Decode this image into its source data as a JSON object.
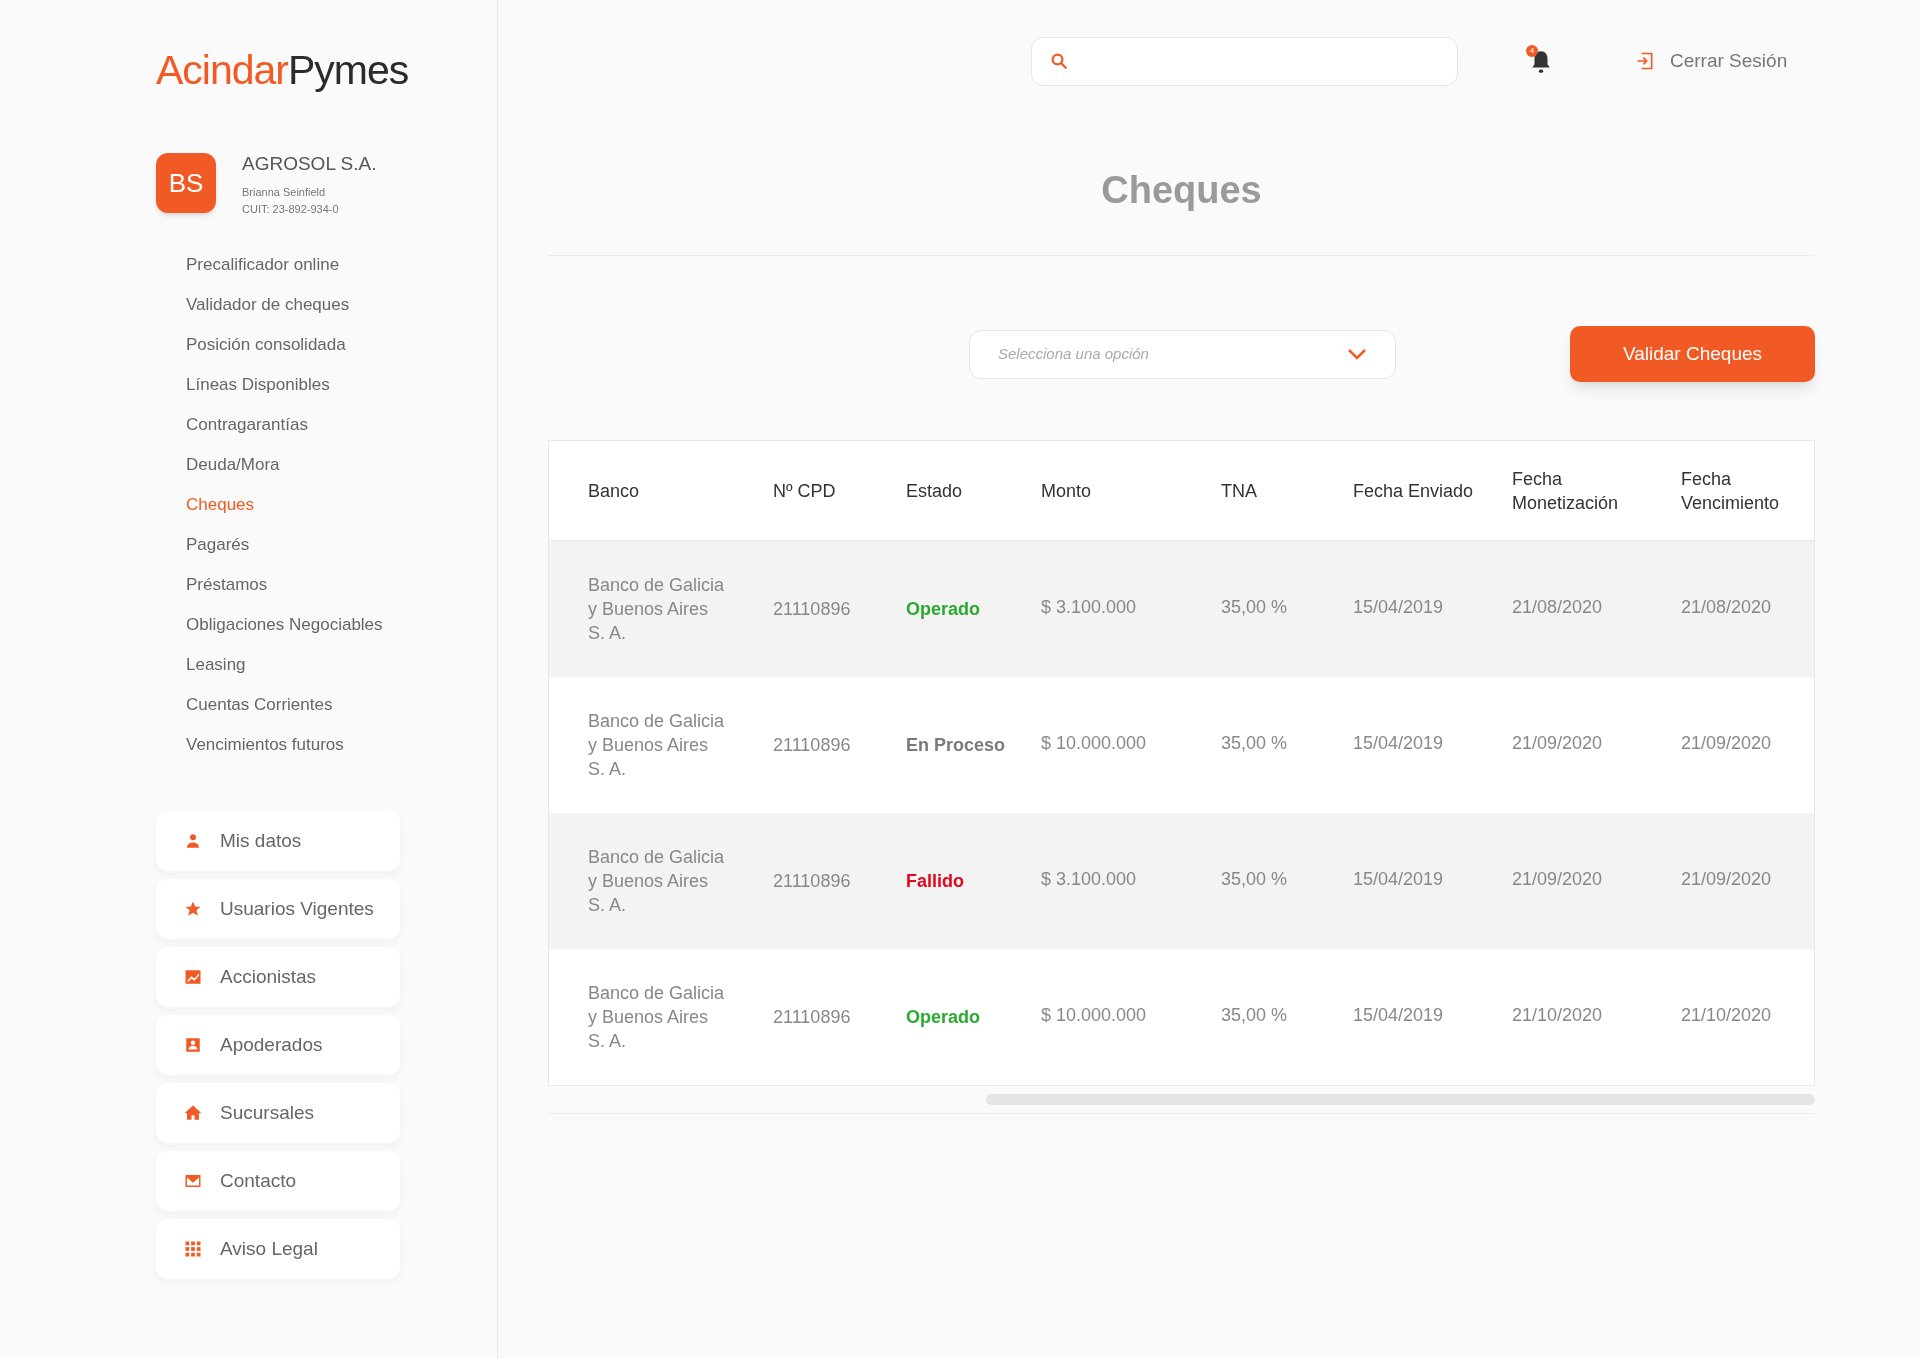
{
  "logo": {
    "part_1": "Acindar",
    "part_2": "Pymes"
  },
  "profile": {
    "initials": "BS",
    "company": "AGROSOL S.A.",
    "user": "Brianna Seinfield",
    "cuit": "CUIT: 23-892-934-0"
  },
  "nav": [
    {
      "label": "Precalificador online",
      "selected": false
    },
    {
      "label": "Validador de cheques",
      "selected": false
    },
    {
      "label": "Posición consolidada",
      "selected": false
    },
    {
      "label": "Líneas Disponibles",
      "selected": false
    },
    {
      "label": "Contragarantías",
      "selected": false
    },
    {
      "label": "Deuda/Mora",
      "selected": false
    },
    {
      "label": "Cheques",
      "selected": true
    },
    {
      "label": "Pagarés",
      "selected": false
    },
    {
      "label": "Préstamos",
      "selected": false
    },
    {
      "label": "Obligaciones Negociables",
      "selected": false
    },
    {
      "label": "Leasing",
      "selected": false
    },
    {
      "label": "Cuentas Corrientes",
      "selected": false
    },
    {
      "label": "Vencimientos futuros",
      "selected": false
    }
  ],
  "quick_links": [
    {
      "label": "Mis datos",
      "kind": "person"
    },
    {
      "label": "Usuarios Vigentes",
      "kind": "star"
    },
    {
      "label": "Accionistas",
      "kind": "chart"
    },
    {
      "label": "Apoderados",
      "kind": "contact"
    },
    {
      "label": "Sucursales",
      "kind": "house"
    },
    {
      "label": "Contacto",
      "kind": "mail"
    },
    {
      "label": "Aviso Legal",
      "kind": "grid"
    }
  ],
  "header": {
    "notification_count": "4",
    "logout": "Cerrar Sesión"
  },
  "title": "Cheques",
  "filter": {
    "placeholder": "Selecciona una opción"
  },
  "validate_button": "Validar Cheques",
  "table": {
    "columns": [
      "Banco",
      "Nº CPD",
      "Estado",
      "Monto",
      "TNA",
      "Fecha Enviado",
      "Fecha Monetización",
      "Fecha Vencimiento"
    ],
    "rows": [
      {
        "banco": "Banco de Galicia y Buenos Aires S. A.",
        "cpd": "21110896",
        "estado": {
          "text": "Operado",
          "color": "#2aa830"
        },
        "monto": "$ 3.100.000",
        "tna": "35,00 %",
        "enviado": "15/04/2019",
        "monetizacion": "21/08/2020",
        "vencimiento": "21/08/2020"
      },
      {
        "banco": "Banco de Galicia y Buenos Aires S. A.",
        "cpd": "21110896",
        "estado": {
          "text": "En Proceso",
          "color": "#7a7a7a"
        },
        "monto": "$ 10.000.000",
        "tna": "35,00 %",
        "enviado": "15/04/2019",
        "monetizacion": "21/09/2020",
        "vencimiento": "21/09/2020"
      },
      {
        "banco": "Banco de Galicia y Buenos Aires S. A.",
        "cpd": "21110896",
        "estado": {
          "text": "Fallido",
          "color": "#e3071d"
        },
        "monto": "$ 3.100.000",
        "tna": "35,00 %",
        "enviado": "15/04/2019",
        "monetizacion": "21/09/2020",
        "vencimiento": "21/09/2020"
      },
      {
        "banco": "Banco de Galicia y Buenos Aires S. A.",
        "cpd": "21110896",
        "estado": {
          "text": "Operado",
          "color": "#2aa830"
        },
        "monto": "$ 10.000.000",
        "tna": "35,00 %",
        "enviado": "15/04/2019",
        "monetizacion": "21/10/2020",
        "vencimiento": "21/10/2020"
      }
    ]
  }
}
